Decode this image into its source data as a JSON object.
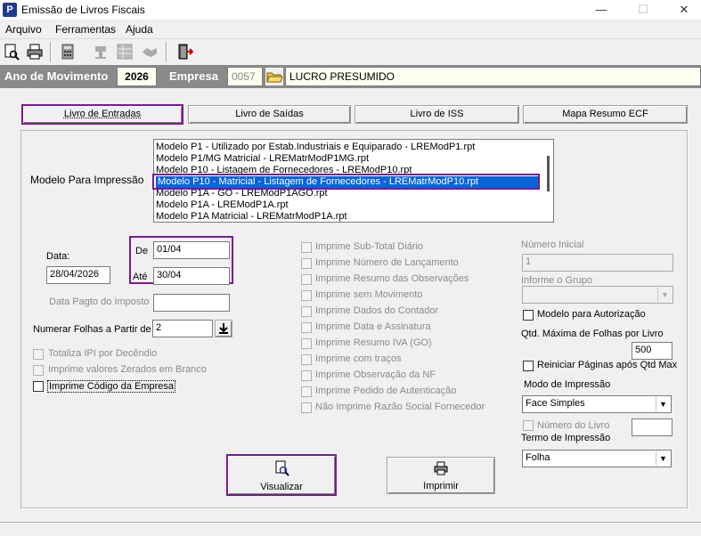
{
  "window": {
    "title": "Emissão de Livros Fiscais",
    "app_icon": "P",
    "minimize": "—",
    "maximize": "☐",
    "close": "✕"
  },
  "menu": [
    "Arquivo",
    "Ferramentas",
    "Ajuda"
  ],
  "header": {
    "ano_label": "Ano de Movimento",
    "ano_value": "2026",
    "empresa_label": "Empresa",
    "empresa_code": "0057",
    "empresa_name": "LUCRO PRESUMIDO"
  },
  "tabs": [
    "Livro de Entradas",
    "Livro de Saídas",
    "Livro de ISS",
    "Mapa Resumo ECF"
  ],
  "modelo": {
    "label": "Modelo Para Impressão",
    "items": [
      "Modelo P1 - Utilizado por Estab.Industriais e Equiparado - LREModP1.rpt",
      "Modelo P1/MG Matricial - LREMatrModP1MG.rpt",
      "Modelo P10 - Listagem de Fornecedores - LREModP10.rpt",
      "Modelo P10 - Matricial - Listagem de Fornecedores - LREMatrModP10.rpt",
      "Modelo P1A - GO - LREModP1AGO.rpt",
      "Modelo P1A - LREModP1A.rpt",
      "Modelo P1A Matricial - LREMatrModP1A.rpt"
    ],
    "selected_index": 3
  },
  "datas": {
    "data_label": "Data:",
    "data_value": "28/04/2026",
    "de_label": "De",
    "de_value": "01/04",
    "ate_label": "Até",
    "ate_value": "30/04",
    "pagto_label": "Data Pagto do Imposto",
    "pagto_value": "",
    "numerar_label": "Numerar Folhas a Partir de",
    "numerar_value": "2"
  },
  "left_checks": [
    {
      "label": "Totaliza IPI por Decêndio",
      "enabled": false
    },
    {
      "label": "Imprime valores Zerados em Branco",
      "enabled": false
    },
    {
      "label": "Imprime Código da Empresa",
      "enabled": true
    }
  ],
  "mid_checks": [
    "Imprime Sub-Total Diário",
    "Imprime Número de Lançamento",
    "Imprime Resumo das Observações",
    "Imprime sem Movimento",
    "Imprime Dados do Contador",
    "Imprime Data e Assinatura",
    "Imprime Resumo IVA (GO)",
    "Imprime com traços",
    "Imprime Observação da NF",
    "Imprime Pedido de Autenticação",
    "Não Imprime Razão Social Fornecedor"
  ],
  "right": {
    "numero_inicial_label": "Número Inicial",
    "numero_inicial_value": "1",
    "grupo_label": "Informe o Grupo",
    "grupo_value": "",
    "modelo_aut_label": "Modelo para Autorização",
    "qtd_label": "Qtd. Máxima de Folhas por Livro",
    "qtd_value": "500",
    "reiniciar_label": "Reiniciar Páginas após Qtd Max",
    "modo_label": "Modo de Impressão",
    "modo_value": "Face Simples",
    "numero_livro_label": "Número do Livro",
    "termo_label": "Termo de Impressão",
    "termo_value": "Folha"
  },
  "actions": {
    "visualizar": "Visualizar",
    "imprimir": "Imprimir"
  },
  "colors": {
    "highlight": "#7b1a8e",
    "selection": "#0a64d8",
    "header_bg": "#8a8a8a"
  }
}
